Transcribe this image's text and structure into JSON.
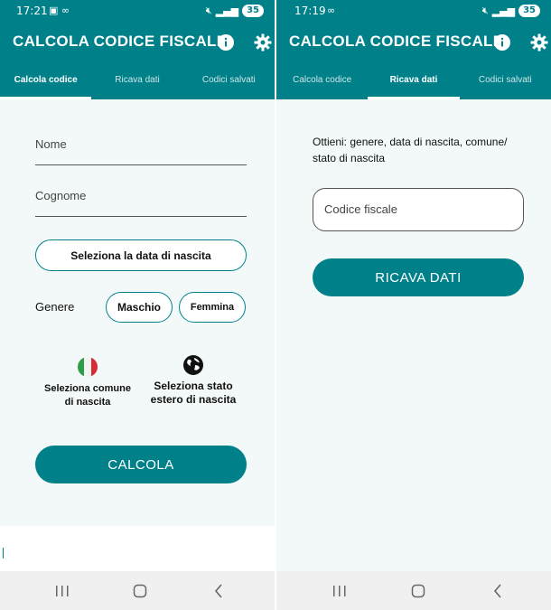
{
  "app": {
    "title": "CALCOLA CODICE FISCALE",
    "accent_color": "#00818a",
    "tabs": [
      "Calcola codice",
      "Ricava dati",
      "Codici salvati"
    ]
  },
  "left": {
    "status": {
      "time": "17:21",
      "battery": "35"
    },
    "active_tab": 0,
    "form": {
      "nome_placeholder": "Nome",
      "cognome_placeholder": "Cognome",
      "birth_date_button": "Seleziona la data di nascita",
      "genere_label": "Genere",
      "maschio": "Maschio",
      "femmina": "Femmina",
      "comune_option": [
        "Seleziona comune",
        "di nascita"
      ],
      "estero_option": [
        "Seleziona stato",
        "estero di nascita"
      ],
      "submit": "CALCOLA"
    }
  },
  "right": {
    "status": {
      "time": "17:19",
      "battery": "35"
    },
    "active_tab": 1,
    "description_lines": [
      "Ottieni: genere, data di nascita, comune/",
      "stato di nascita"
    ],
    "cf_placeholder": "Codice fiscale",
    "submit": "RICAVA DATI"
  },
  "icons": {
    "info": "info-icon",
    "settings": "gear-icon",
    "italy_flag": "italy-flag-icon",
    "globe": "globe-icon"
  }
}
